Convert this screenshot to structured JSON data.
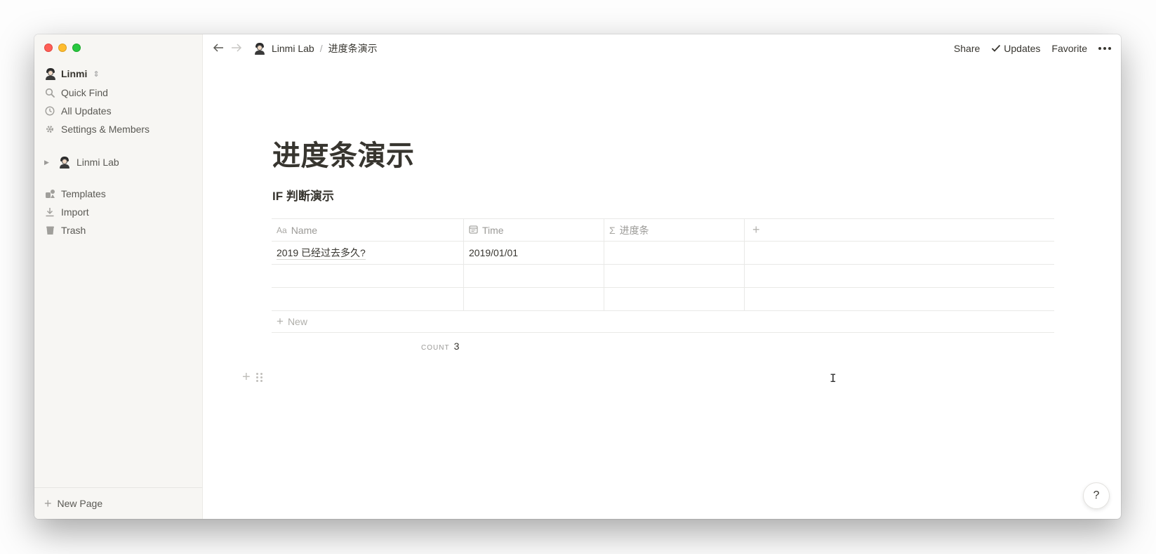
{
  "window": {
    "traffic_lights": {
      "red": "#ff5f57",
      "yellow": "#febc2e",
      "green": "#28c840"
    }
  },
  "sidebar": {
    "workspace_name": "Linmi",
    "workspace_switch_icon": "⇕",
    "items": [
      {
        "label": "Quick Find",
        "icon": "search-icon"
      },
      {
        "label": "All Updates",
        "icon": "clock-icon"
      },
      {
        "label": "Settings & Members",
        "icon": "gear-icon"
      }
    ],
    "tree": [
      {
        "label": "Linmi Lab",
        "icon": "avatar-icon"
      }
    ],
    "tools": [
      {
        "label": "Templates",
        "icon": "templates-icon"
      },
      {
        "label": "Import",
        "icon": "import-icon"
      },
      {
        "label": "Trash",
        "icon": "trash-icon"
      }
    ],
    "new_page_label": "New Page"
  },
  "topbar": {
    "breadcrumb_root": "Linmi Lab",
    "breadcrumb_sep": "/",
    "breadcrumb_page": "进度条演示",
    "share_label": "Share",
    "updates_label": "Updates",
    "favorite_label": "Favorite"
  },
  "page": {
    "title": "进度条演示",
    "database_title": "IF 判断演示",
    "columns": [
      {
        "label": "Name",
        "icon": "Aa"
      },
      {
        "label": "Time",
        "icon": "calendar-icon"
      },
      {
        "label": "进度条",
        "icon": "Σ"
      }
    ],
    "rows": [
      {
        "name": "2019 已经过去多久?",
        "time": "2019/01/01",
        "progress": ""
      },
      {
        "name": "",
        "time": "",
        "progress": ""
      },
      {
        "name": "",
        "time": "",
        "progress": ""
      }
    ],
    "new_row_label": "New",
    "count_label": "COUNT",
    "count_value": "3"
  },
  "help_label": "?"
}
